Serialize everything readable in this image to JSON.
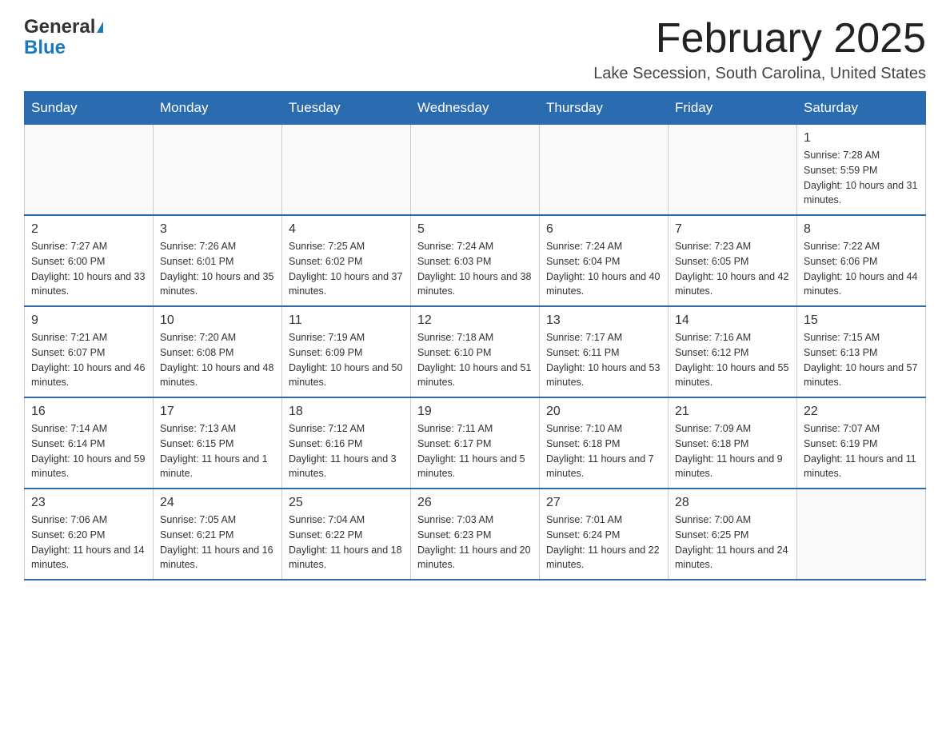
{
  "header": {
    "logo_general": "General",
    "logo_blue": "Blue",
    "month_title": "February 2025",
    "location": "Lake Secession, South Carolina, United States"
  },
  "days_of_week": [
    "Sunday",
    "Monday",
    "Tuesday",
    "Wednesday",
    "Thursday",
    "Friday",
    "Saturday"
  ],
  "weeks": [
    [
      {
        "day": "",
        "info": ""
      },
      {
        "day": "",
        "info": ""
      },
      {
        "day": "",
        "info": ""
      },
      {
        "day": "",
        "info": ""
      },
      {
        "day": "",
        "info": ""
      },
      {
        "day": "",
        "info": ""
      },
      {
        "day": "1",
        "info": "Sunrise: 7:28 AM\nSunset: 5:59 PM\nDaylight: 10 hours and 31 minutes."
      }
    ],
    [
      {
        "day": "2",
        "info": "Sunrise: 7:27 AM\nSunset: 6:00 PM\nDaylight: 10 hours and 33 minutes."
      },
      {
        "day": "3",
        "info": "Sunrise: 7:26 AM\nSunset: 6:01 PM\nDaylight: 10 hours and 35 minutes."
      },
      {
        "day": "4",
        "info": "Sunrise: 7:25 AM\nSunset: 6:02 PM\nDaylight: 10 hours and 37 minutes."
      },
      {
        "day": "5",
        "info": "Sunrise: 7:24 AM\nSunset: 6:03 PM\nDaylight: 10 hours and 38 minutes."
      },
      {
        "day": "6",
        "info": "Sunrise: 7:24 AM\nSunset: 6:04 PM\nDaylight: 10 hours and 40 minutes."
      },
      {
        "day": "7",
        "info": "Sunrise: 7:23 AM\nSunset: 6:05 PM\nDaylight: 10 hours and 42 minutes."
      },
      {
        "day": "8",
        "info": "Sunrise: 7:22 AM\nSunset: 6:06 PM\nDaylight: 10 hours and 44 minutes."
      }
    ],
    [
      {
        "day": "9",
        "info": "Sunrise: 7:21 AM\nSunset: 6:07 PM\nDaylight: 10 hours and 46 minutes."
      },
      {
        "day": "10",
        "info": "Sunrise: 7:20 AM\nSunset: 6:08 PM\nDaylight: 10 hours and 48 minutes."
      },
      {
        "day": "11",
        "info": "Sunrise: 7:19 AM\nSunset: 6:09 PM\nDaylight: 10 hours and 50 minutes."
      },
      {
        "day": "12",
        "info": "Sunrise: 7:18 AM\nSunset: 6:10 PM\nDaylight: 10 hours and 51 minutes."
      },
      {
        "day": "13",
        "info": "Sunrise: 7:17 AM\nSunset: 6:11 PM\nDaylight: 10 hours and 53 minutes."
      },
      {
        "day": "14",
        "info": "Sunrise: 7:16 AM\nSunset: 6:12 PM\nDaylight: 10 hours and 55 minutes."
      },
      {
        "day": "15",
        "info": "Sunrise: 7:15 AM\nSunset: 6:13 PM\nDaylight: 10 hours and 57 minutes."
      }
    ],
    [
      {
        "day": "16",
        "info": "Sunrise: 7:14 AM\nSunset: 6:14 PM\nDaylight: 10 hours and 59 minutes."
      },
      {
        "day": "17",
        "info": "Sunrise: 7:13 AM\nSunset: 6:15 PM\nDaylight: 11 hours and 1 minute."
      },
      {
        "day": "18",
        "info": "Sunrise: 7:12 AM\nSunset: 6:16 PM\nDaylight: 11 hours and 3 minutes."
      },
      {
        "day": "19",
        "info": "Sunrise: 7:11 AM\nSunset: 6:17 PM\nDaylight: 11 hours and 5 minutes."
      },
      {
        "day": "20",
        "info": "Sunrise: 7:10 AM\nSunset: 6:18 PM\nDaylight: 11 hours and 7 minutes."
      },
      {
        "day": "21",
        "info": "Sunrise: 7:09 AM\nSunset: 6:18 PM\nDaylight: 11 hours and 9 minutes."
      },
      {
        "day": "22",
        "info": "Sunrise: 7:07 AM\nSunset: 6:19 PM\nDaylight: 11 hours and 11 minutes."
      }
    ],
    [
      {
        "day": "23",
        "info": "Sunrise: 7:06 AM\nSunset: 6:20 PM\nDaylight: 11 hours and 14 minutes."
      },
      {
        "day": "24",
        "info": "Sunrise: 7:05 AM\nSunset: 6:21 PM\nDaylight: 11 hours and 16 minutes."
      },
      {
        "day": "25",
        "info": "Sunrise: 7:04 AM\nSunset: 6:22 PM\nDaylight: 11 hours and 18 minutes."
      },
      {
        "day": "26",
        "info": "Sunrise: 7:03 AM\nSunset: 6:23 PM\nDaylight: 11 hours and 20 minutes."
      },
      {
        "day": "27",
        "info": "Sunrise: 7:01 AM\nSunset: 6:24 PM\nDaylight: 11 hours and 22 minutes."
      },
      {
        "day": "28",
        "info": "Sunrise: 7:00 AM\nSunset: 6:25 PM\nDaylight: 11 hours and 24 minutes."
      },
      {
        "day": "",
        "info": ""
      }
    ]
  ]
}
